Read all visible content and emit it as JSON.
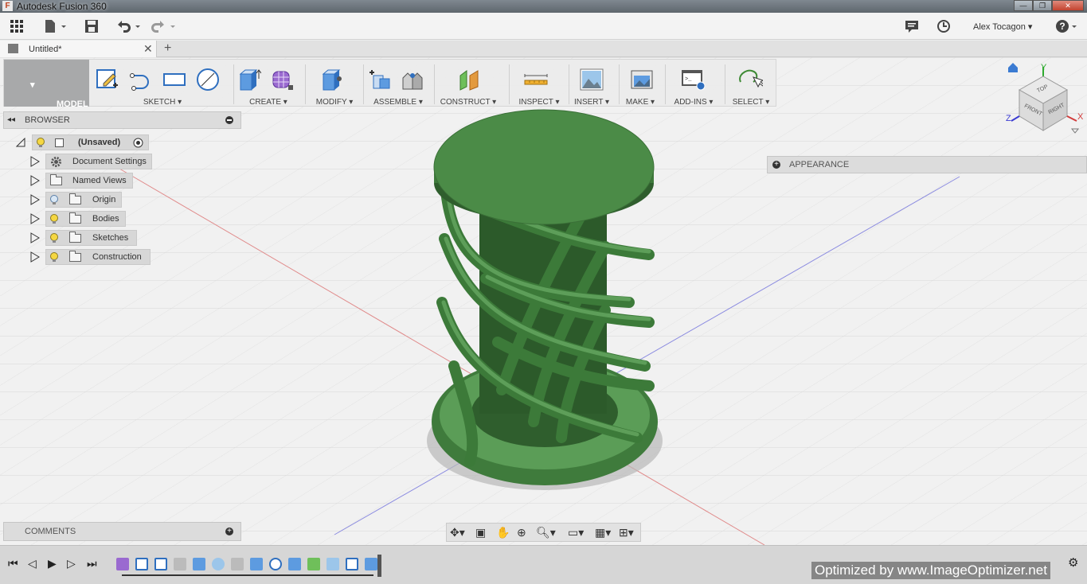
{
  "window": {
    "title": "Autodesk Fusion 360",
    "app_icon": "F",
    "minimize": "—",
    "maximize": "❐",
    "close": "✕"
  },
  "quickbar": {
    "user": "Alex Tocagon"
  },
  "tabs": {
    "document": "Untitled*",
    "close": "✕",
    "new_tab": "+"
  },
  "ribbon": {
    "workspace": "MODEL",
    "groups": [
      {
        "label": "SKETCH"
      },
      {
        "label": "CREATE"
      },
      {
        "label": "MODIFY"
      },
      {
        "label": "ASSEMBLE"
      },
      {
        "label": "CONSTRUCT"
      },
      {
        "label": "INSPECT"
      },
      {
        "label": "INSERT"
      },
      {
        "label": "MAKE"
      },
      {
        "label": "ADD-INS"
      },
      {
        "label": "SELECT"
      }
    ]
  },
  "browser": {
    "title": "BROWSER",
    "root": "(Unsaved)",
    "items": [
      {
        "label": "Document Settings"
      },
      {
        "label": "Named Views"
      },
      {
        "label": "Origin"
      },
      {
        "label": "Bodies"
      },
      {
        "label": "Sketches"
      },
      {
        "label": "Construction"
      }
    ]
  },
  "appearance": {
    "title": "APPEARANCE"
  },
  "comments": {
    "title": "COMMENTS"
  },
  "viewcube": {
    "top": "TOP",
    "front": "FRONT",
    "right": "RIGHT",
    "y": "Y",
    "x": "X",
    "z": "Z"
  },
  "watermark": "Optimized by www.ImageOptimizer.net",
  "colors": {
    "model_green": "#4b8b47",
    "model_dark": "#2f5e2d",
    "workspace_btn": "#a8a9aa"
  }
}
